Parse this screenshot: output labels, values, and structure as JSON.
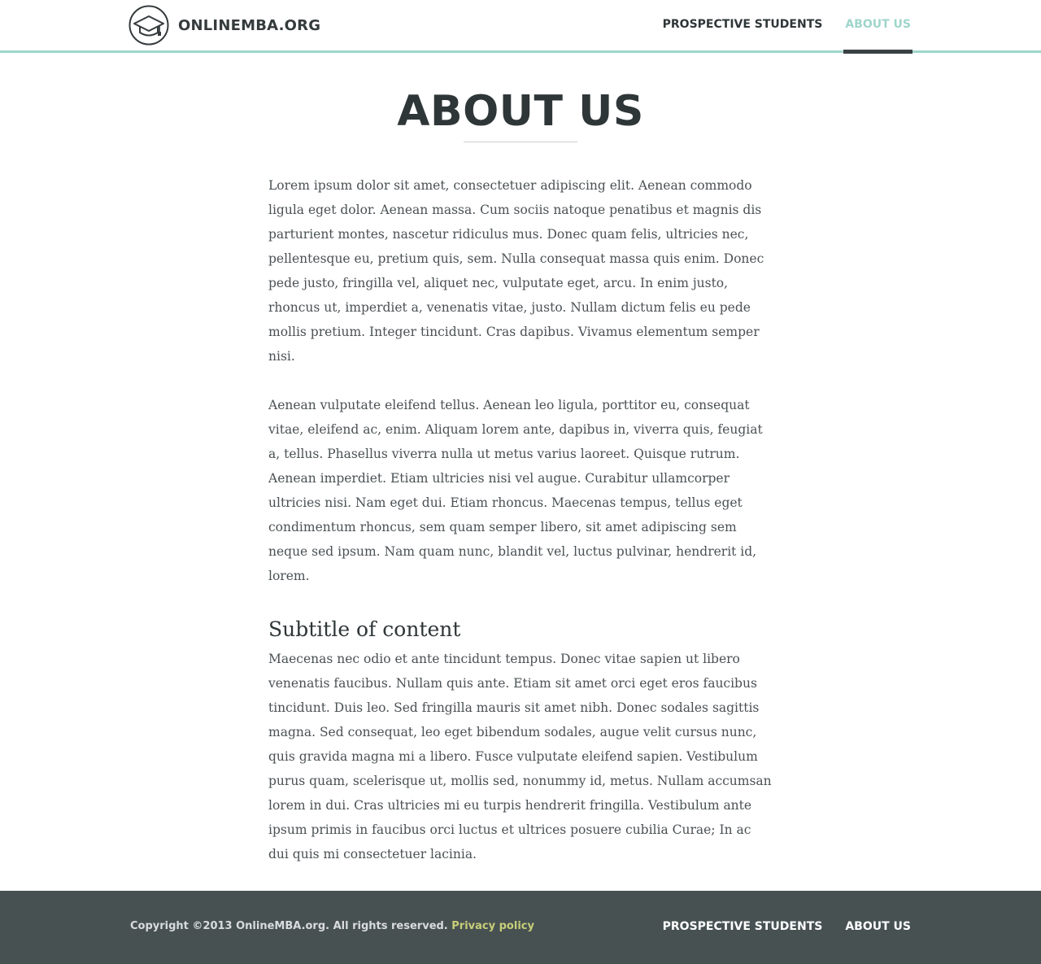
{
  "header": {
    "logo_text": "ONLINEMBA.ORG",
    "logo_icon": "graduation-cap-icon",
    "nav": [
      {
        "label": "PROSPECTIVE STUDENTS",
        "active": false
      },
      {
        "label": "ABOUT US",
        "active": true
      }
    ]
  },
  "main": {
    "title": "ABOUT US",
    "paragraphs": [
      "Lorem ipsum dolor sit amet, consectetuer adipiscing elit. Aenean commodo ligula eget dolor. Aenean massa. Cum sociis natoque penatibus et magnis dis parturient montes, nascetur ridiculus mus. Donec quam felis, ultricies nec, pellentesque eu, pretium quis, sem. Nulla consequat massa quis enim. Donec pede justo, fringilla vel, aliquet nec, vulputate eget, arcu. In enim justo, rhoncus ut, imperdiet a, venenatis vitae, justo. Nullam dictum felis eu pede mollis pretium. Integer tincidunt. Cras dapibus. Vivamus elementum semper nisi.",
      "Aenean vulputate eleifend tellus. Aenean leo ligula, porttitor eu, consequat vitae, eleifend ac, enim. Aliquam lorem ante, dapibus in, viverra quis, feugiat a, tellus. Phasellus viverra nulla ut metus varius laoreet. Quisque rutrum. Aenean imperdiet. Etiam ultricies nisi vel augue. Curabitur ullamcorper ultricies nisi. Nam eget dui. Etiam rhoncus. Maecenas tempus, tellus eget condimentum rhoncus, sem quam semper libero, sit amet adipiscing sem neque sed ipsum. Nam quam nunc, blandit vel, luctus pulvinar, hendrerit id, lorem."
    ],
    "subtitle": "Subtitle of content",
    "subtitle_paragraph": "Maecenas nec odio et ante tincidunt tempus. Donec vitae sapien ut libero venenatis faucibus. Nullam quis ante. Etiam sit amet orci eget eros faucibus tincidunt. Duis leo. Sed fringilla mauris sit amet nibh. Donec sodales sagittis magna. Sed consequat, leo eget bibendum sodales, augue velit cursus nunc, quis gravida magna mi a libero. Fusce vulputate eleifend sapien. Vestibulum purus quam, scelerisque ut, mollis sed, nonummy id, metus. Nullam accumsan lorem in dui. Cras ultricies mi eu turpis hendrerit fringilla. Vestibulum ante ipsum primis in faucibus orci luctus et ultrices posuere cubilia Curae; In ac dui quis mi consectetuer lacinia."
  },
  "footer": {
    "copyright": "Copyright ©2013 OnlineMBA.org. All rights reserved.",
    "privacy_label": "Privacy policy",
    "nav": [
      {
        "label": "PROSPECTIVE STUDENTS"
      },
      {
        "label": "ABOUT US"
      }
    ]
  },
  "colors": {
    "accent": "#9fd6cc",
    "text_dark": "#2f3638",
    "body_text": "#4a5154",
    "footer_bg": "#485152",
    "privacy_link": "#c7cf78",
    "active_tab_bar": "#3a4144"
  }
}
